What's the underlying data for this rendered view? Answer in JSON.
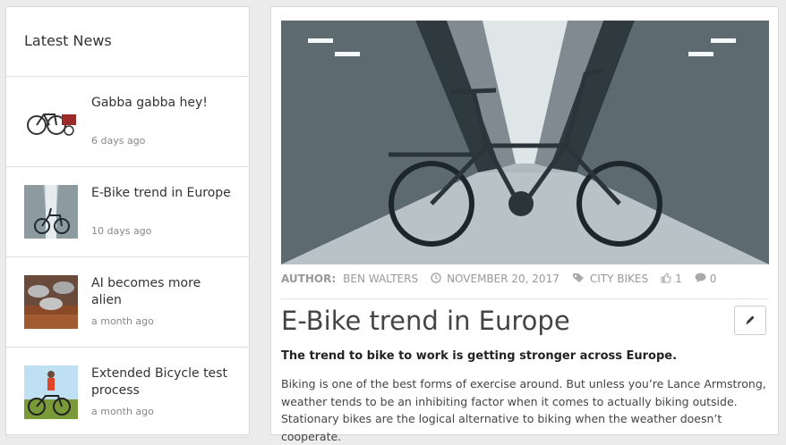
{
  "sidebar": {
    "title": "Latest News",
    "items": [
      {
        "title": "Gabba gabba hey!",
        "date": "6 days ago"
      },
      {
        "title": "E-Bike trend in Europe",
        "date": "10 days ago"
      },
      {
        "title": "AI becomes more alien",
        "date": "a month ago"
      },
      {
        "title": "Extended Bicycle test process",
        "date": "a month ago"
      }
    ]
  },
  "article": {
    "author_label": "AUTHOR:",
    "author": "BEN WALTERS",
    "date": "NOVEMBER 20, 2017",
    "category": "CITY BIKES",
    "likes": "1",
    "comments": "0",
    "title": "E-Bike trend in Europe",
    "lead": "The trend to bike to work is getting stronger across Europe.",
    "body": "Biking is one of the best forms of exercise around. But unless you’re Lance Armstrong, weather tends to be an inhibiting factor when it comes to actually biking outside. Stationary bikes are the logical alternative to biking when the weather doesn’t cooperate."
  },
  "icons": {
    "clock": "clock-icon",
    "tag": "tag-icon",
    "like": "thumbs-up-icon",
    "comment": "comment-icon",
    "edit": "pencil-icon"
  }
}
